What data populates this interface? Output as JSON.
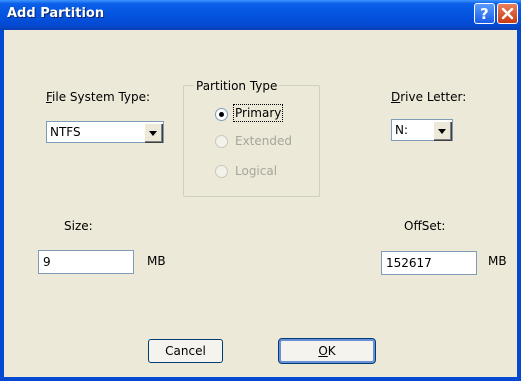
{
  "window": {
    "title": "Add Partition"
  },
  "titlebar": {
    "help_icon": "help-icon",
    "close_icon": "close-icon"
  },
  "file_system": {
    "label_u": "F",
    "label_rest": "ile System Type:",
    "value": "NTFS"
  },
  "partition_type": {
    "title": "Partition Type",
    "options": [
      {
        "label": "Primary",
        "selected": true,
        "enabled": true
      },
      {
        "label": "Extended",
        "selected": false,
        "enabled": false
      },
      {
        "label": "Logical",
        "selected": false,
        "enabled": false
      }
    ]
  },
  "drive_letter": {
    "label_u": "D",
    "label_rest": "rive Letter:",
    "value": "N:"
  },
  "size": {
    "label": "Size:",
    "value": "9",
    "unit": "MB"
  },
  "offset": {
    "label": "OffSet:",
    "value": "152617",
    "unit": "MB"
  },
  "buttons": {
    "cancel": "Cancel",
    "ok_u": "O",
    "ok_rest": "K"
  },
  "colors": {
    "titlebar": "#0454e0",
    "dialog_bg": "#ece9d8",
    "close": "#c83a12"
  }
}
